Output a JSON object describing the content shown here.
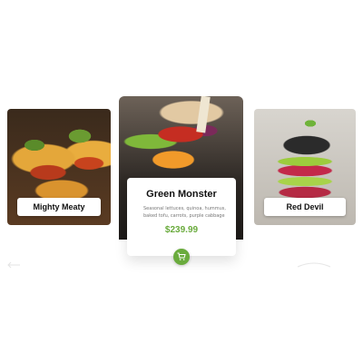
{
  "cards": {
    "left": {
      "name": "Mighty Meaty",
      "image_icon": "tacos-image"
    },
    "center": {
      "name": "Green Monster",
      "description": "Seasonal lettuces, quinoa, hummus, baked tofu, carrots, purple cabbage",
      "price": "$239.99",
      "image_icon": "burger-image"
    },
    "right": {
      "name": "Red Devil",
      "image_icon": "black-burger-image"
    }
  },
  "colors": {
    "accent": "#6aab3d"
  },
  "icons": {
    "cart": "shopping-cart-icon",
    "prev": "prev-arrow-icon",
    "next": "next-arrow-icon"
  }
}
